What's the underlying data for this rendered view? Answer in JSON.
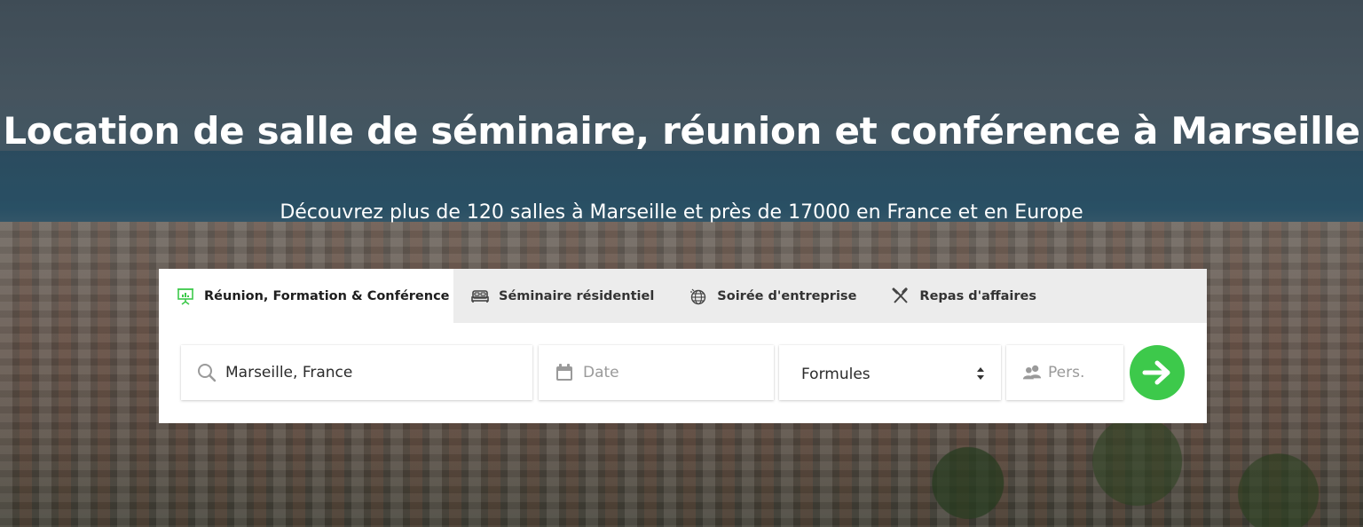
{
  "hero": {
    "title": "Location de salle de séminaire, réunion et conférence à Marseille",
    "subtitle": "Découvrez plus de 120 salles à Marseille et près de 17000 en France et en Europe"
  },
  "tabs": [
    {
      "label": "Réunion, Formation & Conférence",
      "icon": "presentation-icon",
      "active": true
    },
    {
      "label": "Séminaire résidentiel",
      "icon": "bed-icon",
      "active": false
    },
    {
      "label": "Soirée d'entreprise",
      "icon": "disco-ball-icon",
      "active": false
    },
    {
      "label": "Repas d'affaires",
      "icon": "utensils-icon",
      "active": false
    }
  ],
  "search": {
    "location_value": "Marseille, France",
    "date_placeholder": "Date",
    "formula_selected": "Formules",
    "persons_placeholder": "Pers."
  },
  "colors": {
    "accent": "#3dc94b",
    "tab_bar": "#ececec",
    "active_tab_icon": "#3dc94b"
  }
}
